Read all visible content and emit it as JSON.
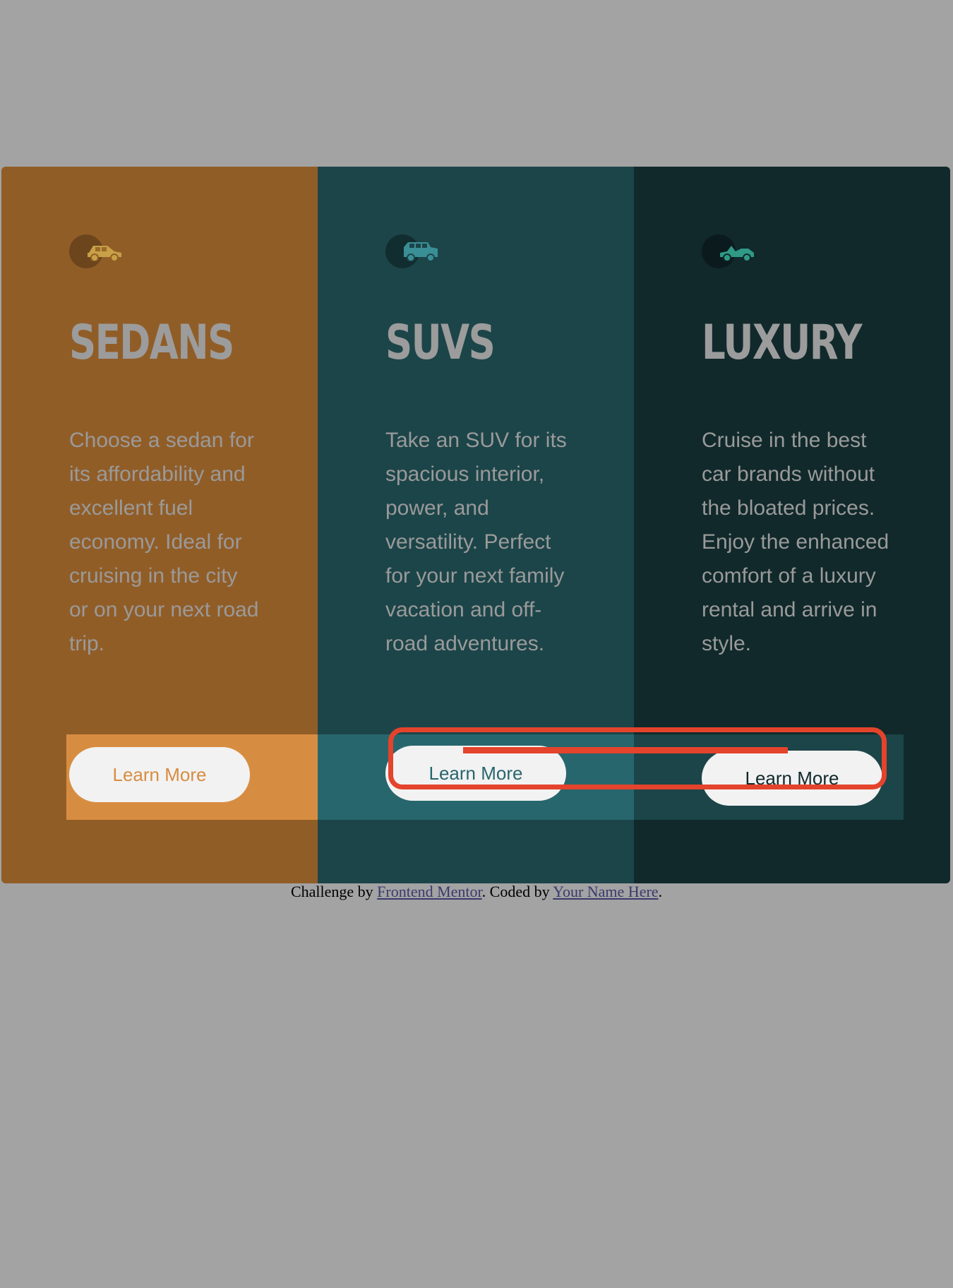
{
  "cards": [
    {
      "icon": "sedan-car-icon",
      "title": "SEDANS",
      "description": "Choose a sedan for its affordability and excellent fuel economy. Ideal for cruising in the city or on your next road trip.",
      "button_label": "Learn More",
      "color": "#915d27",
      "accent": "#d78d41"
    },
    {
      "icon": "suv-car-icon",
      "title": "SUVS",
      "description": "Take an SUV for its spacious interior, power, and versatility. Perfect for your next family vacation and off-road adventures.",
      "button_label": "Learn More",
      "color": "#1c4549",
      "accent": "#28666d"
    },
    {
      "icon": "luxury-car-icon",
      "title": "LUXURY",
      "description": "Cruise in the best car brands without the bloated prices. Enjoy the enhanced comfort of a luxury rental and arrive in style.",
      "button_label": "Learn More",
      "color": "#11292b",
      "accent": "#1b4548"
    }
  ],
  "footer": {
    "prefix": "Challenge by ",
    "mentor_link": "Frontend Mentor",
    "middle": ". Coded by ",
    "author_link": "Your Name Here",
    "suffix": "."
  },
  "colors": {
    "background": "#a3a3a3",
    "highlight": "#e4432c"
  }
}
